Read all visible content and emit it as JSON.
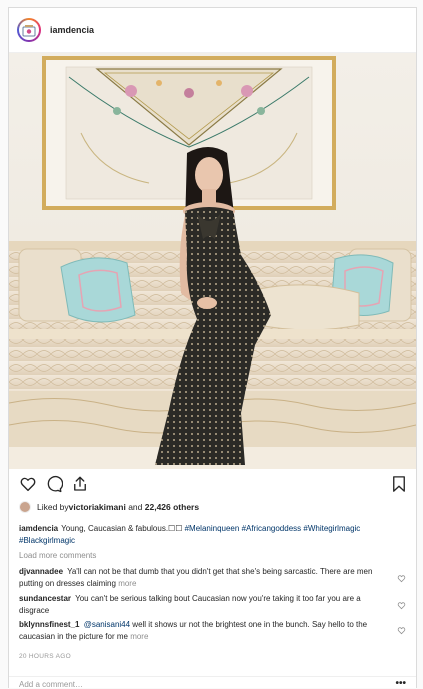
{
  "header": {
    "username": "iamdencia",
    "avatar_icon": "profile-avatar-icon"
  },
  "actions": {
    "like_icon": "heart-icon",
    "comment_icon": "comment-icon",
    "share_icon": "share-icon",
    "save_icon": "bookmark-icon"
  },
  "likes": {
    "prefix": "Liked by ",
    "user": "victoriakimani",
    "middle": " and ",
    "count": "22,426 others"
  },
  "caption": {
    "username": "iamdencia",
    "text": "Young, Caucasian & fabulous.☐☐ ",
    "hashtags": [
      "#Melaninqueen",
      "#Africangoddess",
      "#Whitegirlmagic",
      "#Blackgirlmagic"
    ]
  },
  "load_more": "Load more comments",
  "comments": [
    {
      "username": "djvannadee",
      "text": "Ya'll can not be that dumb that you didn't get that she's being sarcastic. There are men putting on dresses claiming",
      "more": "more"
    },
    {
      "username": "sundancestar",
      "text": "You can't be serious talking bout Caucasian now you're taking it too far you are a disgrace",
      "more": ""
    },
    {
      "username": "bklynnsfinest_1",
      "mention": "@sanisani44",
      "text": " well it shows ur not the brightest one in the bunch. Say hello to the caucasian in the picture for me",
      "more": "more"
    }
  ],
  "timestamp": "20 HOURS AGO",
  "add_comment": {
    "placeholder": "Add a comment…",
    "options_label": "•••"
  },
  "colors": {
    "link": "#003569",
    "muted": "#8e8e8e",
    "border": "#dbdbdb"
  }
}
